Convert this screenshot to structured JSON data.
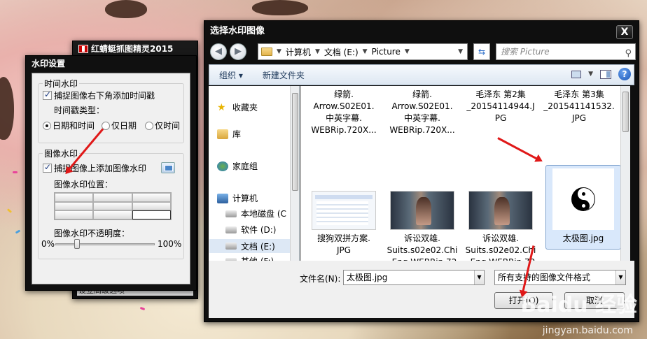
{
  "app_window": {
    "title": "红蜻蜓抓图精灵2015",
    "footer": "设立高级选项"
  },
  "watermark_dialog": {
    "title": "水印设置",
    "time_group": {
      "title": "时间水印",
      "add_timestamp_label": "捕捉图像右下角添加时间戳",
      "add_timestamp_checked": true,
      "type_label": "时间戳类型：",
      "options": [
        "日期和时间",
        "仅日期",
        "仅时间"
      ],
      "selected": "日期和时间"
    },
    "image_group": {
      "title": "图像水印",
      "add_image_label": "捕捉图像上添加图像水印",
      "add_image_checked": true,
      "position_label": "图像水印位置：",
      "opacity_label": "图像水印不透明度：",
      "opacity_min": "0%",
      "opacity_max": "100%",
      "opacity_value": 0.2
    }
  },
  "file_dialog": {
    "title": "选择水印图像",
    "close_label": "X",
    "breadcrumb": [
      "计算机",
      "文档 (E:)",
      "Picture"
    ],
    "search_placeholder": "搜索 Picture",
    "toolbar": {
      "organize": "组织 ▾",
      "new_folder": "新建文件夹",
      "help": "?"
    },
    "nav": [
      {
        "label": "收藏夹",
        "icon": "star-icon"
      },
      {
        "label": "库",
        "icon": "library-icon"
      },
      {
        "label": "家庭组",
        "icon": "homegroup-icon"
      },
      {
        "label": "计算机",
        "icon": "computer-icon"
      },
      {
        "label": "本地磁盘 (C",
        "icon": "drive-icon"
      },
      {
        "label": "软件 (D:)",
        "icon": "drive-icon"
      },
      {
        "label": "文档 (E:)",
        "icon": "drive-icon"
      },
      {
        "label": "其他 (F:)",
        "icon": "drive-icon"
      }
    ],
    "files_top": [
      {
        "name": "绿箭.\nArrow.S02E01.\n中英字幕.\nWEBRip.720X..."
      },
      {
        "name": "绿箭.\nArrow.S02E01.\n中英字幕.\nWEBRip.720X..."
      },
      {
        "name": "毛泽东 第2集\n_20154114944.J\nPG"
      },
      {
        "name": "毛泽东 第3集\n_201541141532.\nJPG"
      }
    ],
    "files_bottom": [
      {
        "name": "搜狗双拼方案.\nJPG"
      },
      {
        "name": "诉讼双雄.\nSuits.s02e02.Chi\n_Eng.WEBRip.72\n0X400-YYeTs..."
      },
      {
        "name": "诉讼双雄.\nSuits.s02e02.Chi\n_Eng.WEBRip.72\n0X400-YYeTs..."
      },
      {
        "name": "太极图.jpg"
      }
    ],
    "filename_label": "文件名(N):",
    "filename_value": "太极图.jpg",
    "filetype_value": "所有支持的图像文件格式",
    "open_label": "打开(O)",
    "cancel_label": "取消"
  },
  "watermark_text": {
    "logo": "Baidu 经验",
    "url": "jingyan.baidu.com"
  },
  "colors": {
    "arrow": "#e01818",
    "link_text": "#1e395b",
    "selection": "#d9e8fb"
  }
}
